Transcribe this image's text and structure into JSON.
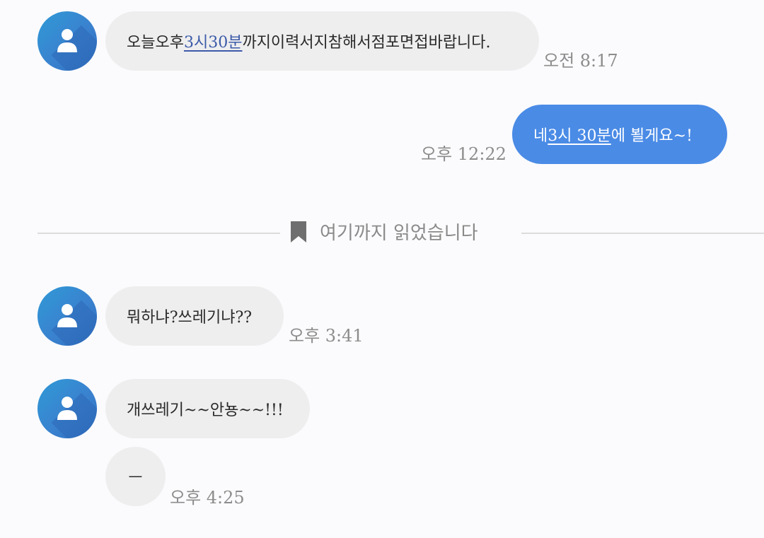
{
  "messages": [
    {
      "pre": "오늘오후",
      "link": "3시30분",
      "post": "까지이력서지참해서점포면접바랍니다.",
      "time": "오전 8:17"
    },
    {
      "pre": "네 ",
      "link": "3시 30분",
      "post": "에 뵐게요~!",
      "time": "오후 12:22"
    },
    {
      "text": "뭐하냐?쓰레기냐??",
      "time": "오후 3:41"
    },
    {
      "text": "개쓰레기~~안뇽~~!!!"
    },
    {
      "text": "ㅡ",
      "time": "오후 4:25"
    }
  ],
  "read_marker": {
    "label": "여기까지 읽었습니다",
    "icon": "bookmark-icon"
  },
  "colors": {
    "outgoing_bubble": "#4a8be6",
    "incoming_bubble": "#eeeeef",
    "link_incoming": "#3b5aa8",
    "timestamp": "#8c8c8c",
    "avatar": "#3a82cf"
  }
}
